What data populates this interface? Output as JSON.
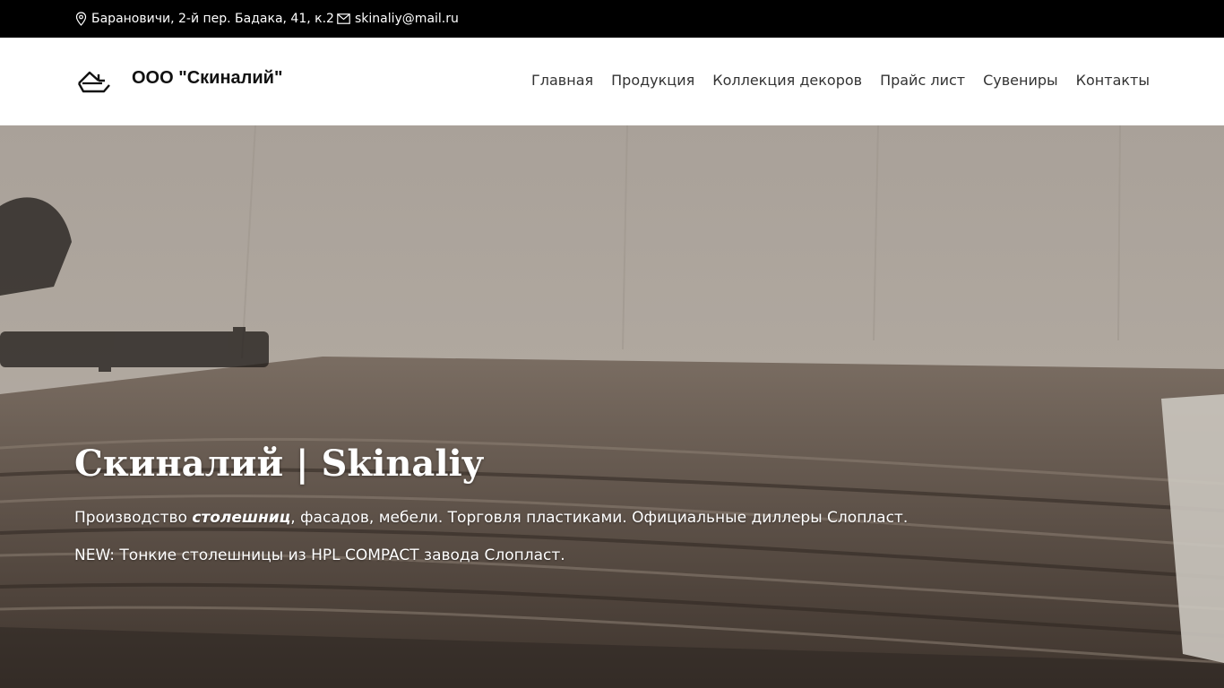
{
  "topbar": {
    "address": "Барановичи, 2-й пер. Бадака, 41, к.2",
    "email": "skinaliy@mail.ru",
    "address_icon": "map-pin-icon",
    "email_icon": "envelope-icon"
  },
  "header": {
    "brand": "ООО \"Скиналий\"",
    "logo_icon": "house-arrow-logo-icon",
    "nav": [
      {
        "label": "Главная"
      },
      {
        "label": "Продукция"
      },
      {
        "label": "Коллекция декоров"
      },
      {
        "label": "Прайс лист"
      },
      {
        "label": "Сувениры"
      },
      {
        "label": "Контакты"
      }
    ]
  },
  "hero": {
    "title": "Скиналий | Skinaliy",
    "line1_pre": "Производство ",
    "line1_em": "столешниц",
    "line1_post": ", фасадов, мебели. Торговля пластиками. Официальные диллеры Слопласт.",
    "line2": "NEW: Тонкие столешницы из HPL COMPACT завода Слопласт.",
    "background": "kitchen-countertop-photo"
  },
  "colors": {
    "topbar_bg": "#000000",
    "header_bg": "#ffffff",
    "nav_text": "#333333",
    "hero_text": "#ffffff"
  }
}
